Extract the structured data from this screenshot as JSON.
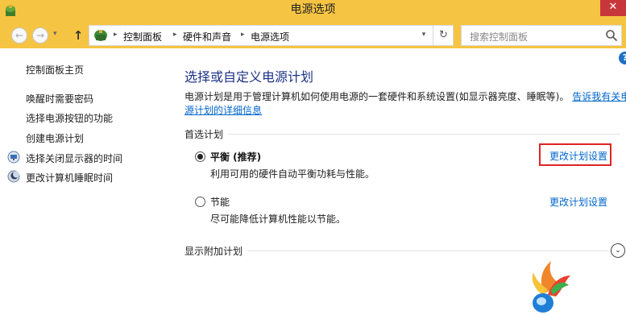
{
  "window": {
    "title": "电源选项",
    "close_glyph": "✕",
    "app_icon": "power-options-icon"
  },
  "addressbar": {
    "back_glyph": "←",
    "forward_glyph": "→",
    "history_glyph": "▾",
    "up_glyph": "↑",
    "breadcrumb": [
      "控制面板",
      "硬件和声音",
      "电源选项"
    ],
    "breadcrumb_separator": "▸",
    "dropdown_glyph": "▾",
    "refresh_glyph": "↻",
    "search_placeholder": "搜索控制面板"
  },
  "sidebar": {
    "home_label": "控制面板主页",
    "items": [
      {
        "label": "唤醒时需要密码",
        "icon": ""
      },
      {
        "label": "选择电源按钮的功能",
        "icon": ""
      },
      {
        "label": "创建电源计划",
        "icon": ""
      },
      {
        "label": "选择关闭显示器的时间",
        "icon": "monitor-icon"
      },
      {
        "label": "更改计算机睡眠时间",
        "icon": "moon-icon"
      }
    ]
  },
  "main": {
    "title": "选择或自定义电源计划",
    "help_glyph": "?",
    "description_line1": "电源计划是用于管理计算机如何使用电源的一套硬件和系统设置(如显示器亮度、睡眠等)。",
    "description_link_part1": "告诉我有关电",
    "description_link_part2": "源计划的详细信息",
    "preferred_section": "首选计划",
    "plans": [
      {
        "name": "平衡 (推荐)",
        "description": "利用可用的硬件自动平衡功耗与性能。",
        "selected": true,
        "link": "更改计划设置"
      },
      {
        "name": "节能",
        "description": "尽可能降低计算机性能以节能。",
        "selected": false,
        "link": "更改计划设置"
      }
    ],
    "additional_section": "显示附加计划",
    "expand_glyph": "⌄"
  },
  "colors": {
    "title_bar": "#f6c443",
    "close_button": "#c7363a",
    "title_text": "#1e3287",
    "link": "#0066cc",
    "highlight": "#e02424"
  }
}
